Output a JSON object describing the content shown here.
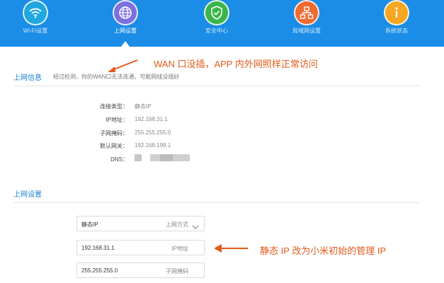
{
  "nav": {
    "items": [
      {
        "label": "Wi-Fi设置",
        "icon": "wifi-icon"
      },
      {
        "label": "上网设置",
        "icon": "globe-icon"
      },
      {
        "label": "安全中心",
        "icon": "shield-icon"
      },
      {
        "label": "局域网设置",
        "icon": "network-tree-icon"
      },
      {
        "label": "系统状态",
        "icon": "info-icon"
      }
    ],
    "active_index": 1
  },
  "colors": {
    "nav_bg": "#1b8de6",
    "wifi": "#21a7e0",
    "globe": "#7c6fe0",
    "shield": "#3bb54a",
    "network": "#ef6a2e",
    "info": "#f5a623",
    "annotation": "#e25a1b",
    "section_title": "#1a7fd4"
  },
  "internet_info": {
    "title": "上网信息",
    "hint": "经过检测，你的WAN口无法连通，可能网线没插好",
    "rows": [
      {
        "label": "连接类型：",
        "value": "静态IP"
      },
      {
        "label": "IP地址：",
        "value": "192.168.31.1"
      },
      {
        "label": "子网掩码：",
        "value": "255.255.255.0"
      },
      {
        "label": "默认网关：",
        "value": "192.168.199.1"
      },
      {
        "label": "DNS："
      }
    ]
  },
  "internet_settings": {
    "title": "上网设置",
    "mode_value": "静态IP",
    "mode_label": "上网方式",
    "ip_value": "192.168.31.1",
    "ip_label": "IP地址",
    "mask_value": "255.255.255.0",
    "mask_label": "子网掩码"
  },
  "annotations": {
    "top": "WAN 口没插，APP 内外网照样正常访问",
    "bottom": "静态 IP 改为小米初始的管理 IP"
  }
}
